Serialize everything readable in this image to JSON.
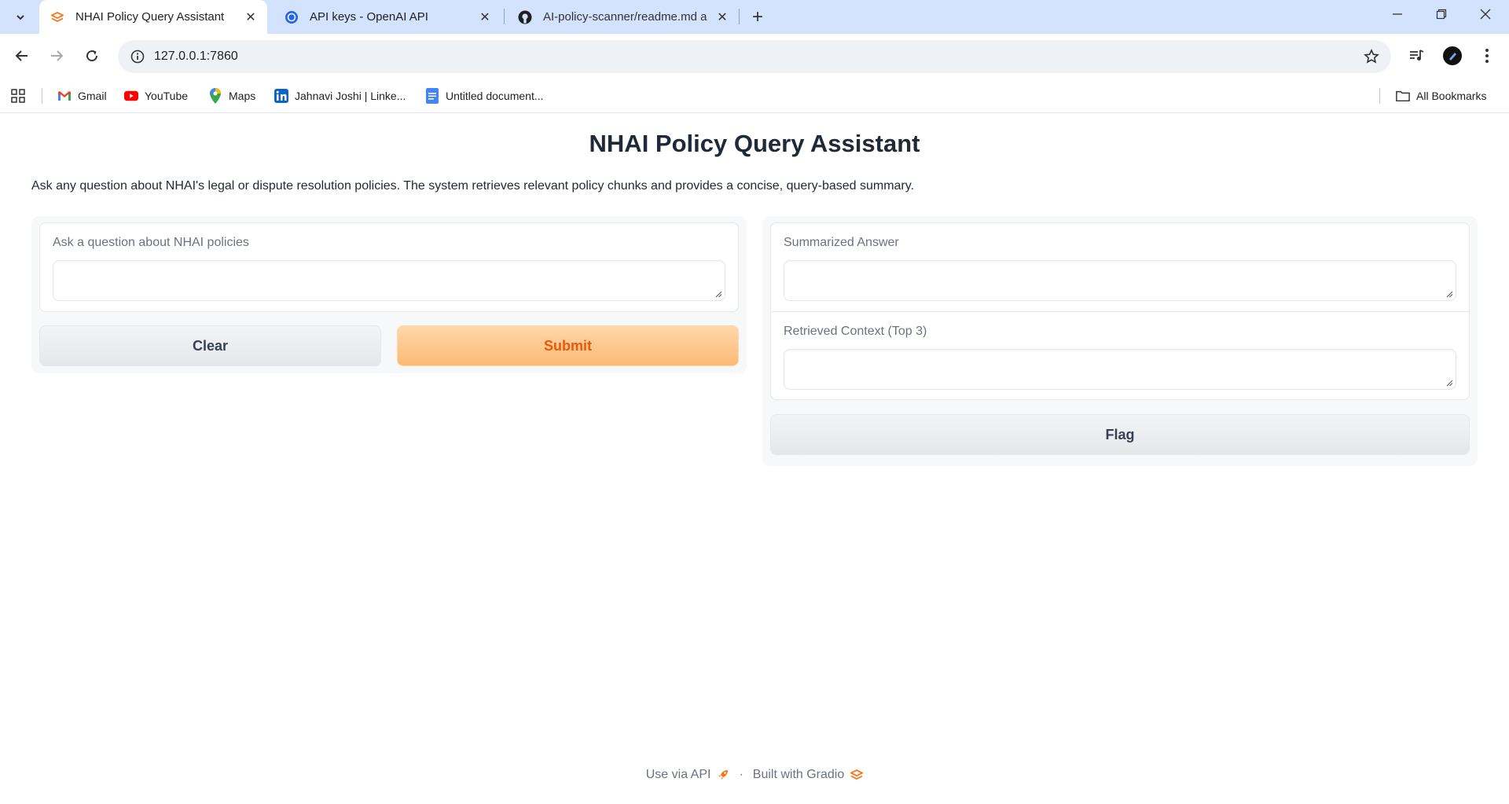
{
  "browser": {
    "tabs": [
      {
        "title": "NHAI Policy Query Assistant",
        "icon": "gradio-icon",
        "active": true
      },
      {
        "title": "API keys - OpenAI API",
        "icon": "openai-icon",
        "active": false
      },
      {
        "title": "AI-policy-scanner/readme.md a",
        "icon": "github-icon",
        "active": false
      }
    ],
    "url": "127.0.0.1:7860",
    "bookmarks": [
      {
        "label": "Gmail",
        "icon": "gmail-icon"
      },
      {
        "label": "YouTube",
        "icon": "youtube-icon"
      },
      {
        "label": "Maps",
        "icon": "maps-icon"
      },
      {
        "label": "Jahnavi Joshi | Linke...",
        "icon": "linkedin-icon"
      },
      {
        "label": "Untitled document...",
        "icon": "docs-icon"
      }
    ],
    "all_bookmarks": "All Bookmarks"
  },
  "app": {
    "title": "NHAI Policy Query Assistant",
    "description": "Ask any question about NHAI's legal or dispute resolution policies. The system retrieves relevant policy chunks and provides a concise, query-based summary.",
    "input": {
      "label": "Ask a question about NHAI policies",
      "value": ""
    },
    "buttons": {
      "clear": "Clear",
      "submit": "Submit",
      "flag": "Flag"
    },
    "outputs": {
      "summary": {
        "label": "Summarized Answer",
        "value": ""
      },
      "context": {
        "label": "Retrieved Context (Top 3)",
        "value": ""
      }
    },
    "footer": {
      "api": "Use via API",
      "separator": "·",
      "built": "Built with Gradio"
    }
  },
  "colors": {
    "primary_text": "#ea580c",
    "primary_bg": "#fdba74",
    "chrome_bg": "#d3e3fd"
  }
}
